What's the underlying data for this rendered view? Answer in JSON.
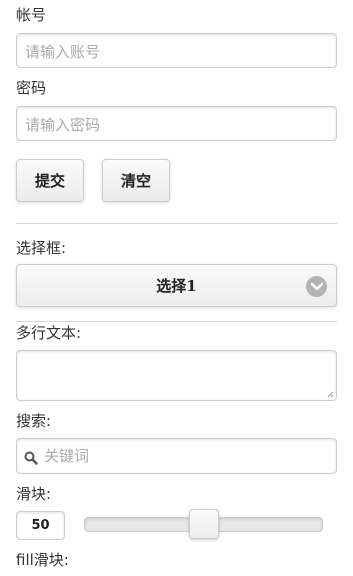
{
  "account": {
    "label": "帐号",
    "placeholder": "请输入账号"
  },
  "password": {
    "label": "密码",
    "placeholder": "请输入密码"
  },
  "buttons": {
    "submit": "提交",
    "clear": "清空"
  },
  "select": {
    "label": "选择框:",
    "selected": "选择1"
  },
  "textarea": {
    "label": "多行文本:"
  },
  "search": {
    "label": "搜索:",
    "placeholder": "关键词"
  },
  "slider": {
    "label": "滑块:",
    "value": "50",
    "min": 0,
    "max": 100
  },
  "fill_slider": {
    "label": "fill滑块:"
  }
}
